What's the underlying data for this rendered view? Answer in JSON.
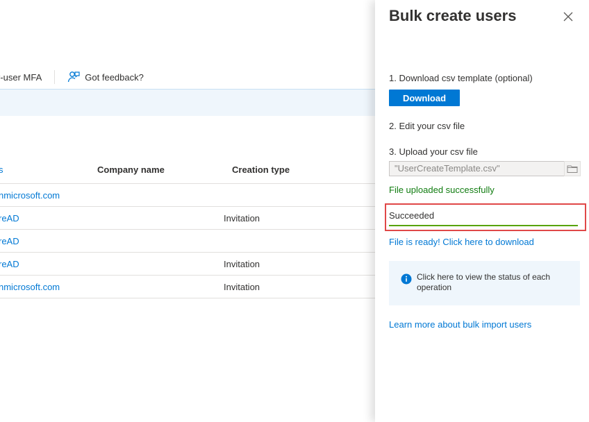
{
  "toolbar": {
    "mfa_label": "r-user MFA",
    "feedback_label": "Got feedback?",
    "feedback_icon": "feedback-person-icon"
  },
  "table": {
    "headers": [
      "s",
      "Company name",
      "Creation type"
    ],
    "rows": [
      {
        "name": "nmicrosoft.com",
        "creation_type": ""
      },
      {
        "name": "reAD",
        "creation_type": "Invitation"
      },
      {
        "name": "reAD",
        "creation_type": ""
      },
      {
        "name": "reAD",
        "creation_type": "Invitation"
      },
      {
        "name": "nmicrosoft.com",
        "creation_type": "Invitation"
      }
    ]
  },
  "panel": {
    "title": "Bulk create users",
    "close_icon": "close-icon",
    "step1": "1. Download csv template (optional)",
    "download_label": "Download",
    "step2": "2. Edit your csv file",
    "step3": "3. Upload your csv file",
    "file_value": "\"UserCreateTemplate.csv\"",
    "folder_icon": "folder-icon",
    "upload_status": "File uploaded successfully",
    "status_value": "Succeeded",
    "ready_link": "File is ready! Click here to download",
    "info_text": "Click here to view the status of each operation",
    "info_icon": "info-icon",
    "learn_more": "Learn more about bulk import users"
  },
  "colors": {
    "accent": "#0078d4",
    "success": "#107c10",
    "success_underline": "#57a300",
    "highlight": "#e04747",
    "info_bg": "#eff6fc"
  }
}
